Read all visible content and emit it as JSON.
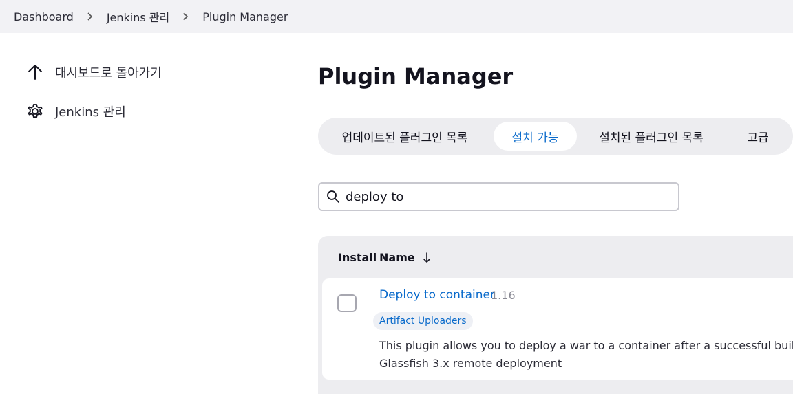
{
  "breadcrumb": {
    "items": [
      "Dashboard",
      "Jenkins 관리",
      "Plugin Manager"
    ]
  },
  "sidebar": {
    "items": [
      {
        "label": "대시보드로 돌아가기",
        "icon": "arrow-up-icon"
      },
      {
        "label": "Jenkins 관리",
        "icon": "gear-icon"
      }
    ]
  },
  "main": {
    "title": "Plugin Manager",
    "tabs": [
      {
        "label": "업데이트된 플러그인 목록",
        "active": false
      },
      {
        "label": "설치 가능",
        "active": true
      },
      {
        "label": "설치된 플러그인 목록",
        "active": false
      },
      {
        "label": "고급",
        "active": false
      }
    ],
    "search": {
      "value": "deploy to",
      "icon": "search-icon"
    },
    "table": {
      "headers": {
        "install": "Install",
        "name": "Name"
      },
      "sort_icon": "sort-down-arrow-icon",
      "rows": [
        {
          "name": "Deploy to container",
          "version": "1.16",
          "tag": "Artifact Uploaders",
          "description": "This plugin allows you to deploy a war to a container after a successful build.\nGlassfish 3.x remote deployment",
          "checked": false
        }
      ]
    }
  },
  "colors": {
    "accent": "#0b6bcb",
    "breadcrumb_bg": "#f2f2f5",
    "tabbar_bg": "#ededf0"
  }
}
